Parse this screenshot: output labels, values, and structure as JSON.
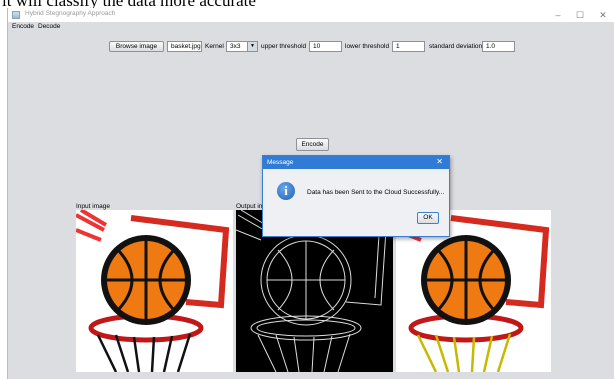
{
  "doc_text": "it will classify the data more accurate",
  "window": {
    "title": "Hybrid Stegnography Approach",
    "controls": [
      "–",
      "☐",
      "✕"
    ]
  },
  "menu": [
    "Encode",
    "Decode"
  ],
  "toolbar": {
    "browse_label": "Browse image",
    "file_value": "basket.jpg",
    "kernel_label": "Kernel",
    "kernel_value": "3x3",
    "upper_label": "upper threshold",
    "upper_value": "10",
    "lower_label": "lower threshold",
    "lower_value": "1",
    "stddev_label": "standard deviation",
    "stddev_value": "1.0"
  },
  "encode_label": "Encode",
  "panels": {
    "input_label": "Input image",
    "output_label": "Output image"
  },
  "dialog": {
    "title": "Message",
    "close": "✕",
    "icon": "i",
    "message": "Data has been Sent to the Cloud Successfully...",
    "ok_label": "OK"
  },
  "colors": {
    "accent": "#2f7bd6",
    "ball": "#f07a12",
    "rim": "#d42a1f"
  }
}
